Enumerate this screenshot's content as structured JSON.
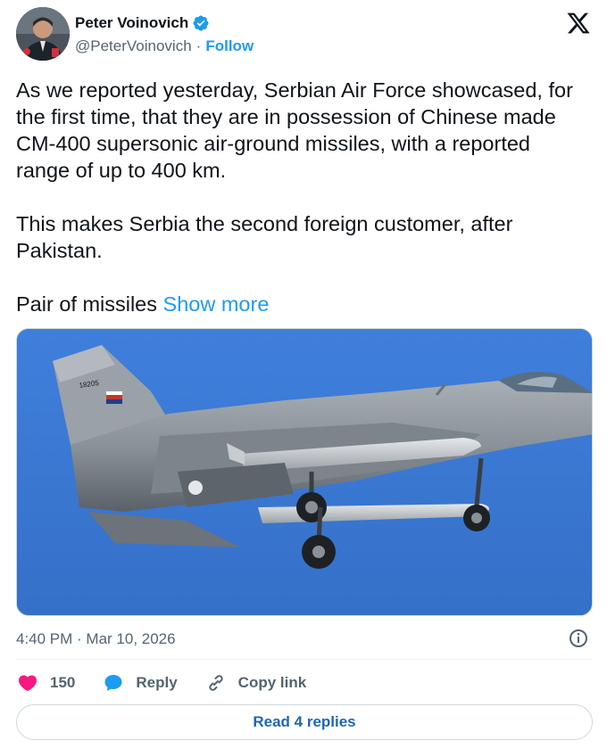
{
  "author": {
    "name": "Peter Voinovich",
    "handle": "@PeterVoinovich",
    "separator": "·",
    "follow_label": "Follow",
    "verified": true
  },
  "tweet": {
    "paragraph_1": "As we reported yesterday, Serbian Air Force showcased, for the first time, that they are in possession of Chinese made CM-400 supersonic air-ground missiles, with a reported range of up to 400 km.",
    "paragraph_2": "This makes Serbia the second foreign customer, after Pakistan.",
    "paragraph_3": "Pair of missiles ",
    "show_more_label": "Show more"
  },
  "media": {
    "aircraft_serial": "18205"
  },
  "meta": {
    "timestamp": "4:40 PM · Mar 10, 2026"
  },
  "actions": {
    "like_count": "150",
    "reply_label": "Reply",
    "copy_link_label": "Copy link"
  },
  "read_replies_label": "Read 4 replies",
  "colors": {
    "accent": "#1d9bf0",
    "like": "#f91880",
    "text": "#0f1419",
    "secondary": "#536471",
    "sky": "#3d7bd6"
  }
}
